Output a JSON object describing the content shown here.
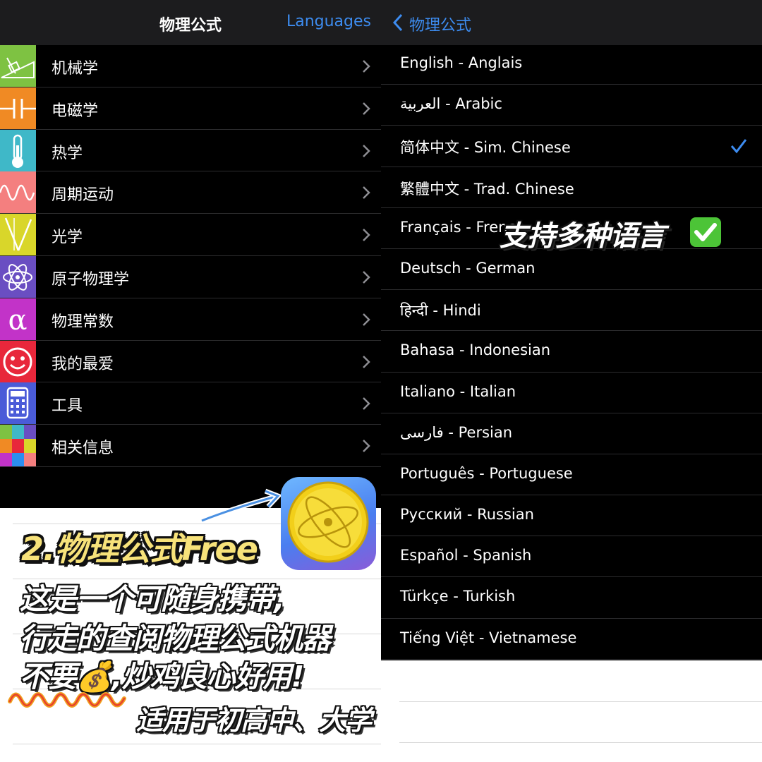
{
  "left_nav": {
    "title": "物理公式",
    "action": "Languages"
  },
  "categories": [
    {
      "label": "机械学",
      "icon": "incline-plane-icon",
      "color": "#7ec242"
    },
    {
      "label": "电磁学",
      "icon": "capacitor-icon",
      "color": "#f08a24"
    },
    {
      "label": "热学",
      "icon": "thermometer-icon",
      "color": "#3fb8c8"
    },
    {
      "label": "周期运动",
      "icon": "sine-wave-icon",
      "color": "#f47f7f"
    },
    {
      "label": "光学",
      "icon": "light-ray-icon",
      "color": "#d9d62a"
    },
    {
      "label": "原子物理学",
      "icon": "atom-icon",
      "color": "#6a4ec2"
    },
    {
      "label": "物理常数",
      "icon": "alpha-icon",
      "color": "#c233c8"
    },
    {
      "label": "我的最爱",
      "icon": "smiley-icon",
      "color": "#e8273b"
    },
    {
      "label": "工具",
      "icon": "calculator-icon",
      "color": "#4a5bd8"
    },
    {
      "label": "相关信息",
      "icon": "info-grid-icon",
      "color": "#2b8ef0"
    }
  ],
  "overlay": {
    "app_name": "2.物理公式Free",
    "desc_lines": [
      "这是一个可随身携带,",
      "行走的查阅物理公式机器",
      "不要💰,炒鸡良心好用!"
    ],
    "audience": "适用于初高中、大学",
    "languages_note": "支持多种语言"
  },
  "right_nav": {
    "back_label": "物理公式"
  },
  "languages": [
    {
      "label": "English - Anglais",
      "selected": false
    },
    {
      "label": "العربية - Arabic",
      "selected": false
    },
    {
      "label": "简体中文 - Sim. Chinese",
      "selected": true
    },
    {
      "label": "繁體中文 - Trad. Chinese",
      "selected": false
    },
    {
      "label": "Français - French",
      "selected": false
    },
    {
      "label": "Deutsch - German",
      "selected": false
    },
    {
      "label": "हिन्दी - Hindi",
      "selected": false
    },
    {
      "label": "Bahasa - Indonesian",
      "selected": false
    },
    {
      "label": "Italiano - Italian",
      "selected": false
    },
    {
      "label": "فارسی - Persian",
      "selected": false
    },
    {
      "label": "Português - Portuguese",
      "selected": false
    },
    {
      "label": "Русский - Russian",
      "selected": false
    },
    {
      "label": "Español - Spanish",
      "selected": false
    },
    {
      "label": "Türkçe - Turkish",
      "selected": false
    },
    {
      "label": "Tiếng Việt - Vietnamese",
      "selected": false
    }
  ],
  "colors": {
    "accent": "#3d8cf0",
    "check": "#3d8cf0",
    "highlight_yellow": "#f7e27a"
  }
}
